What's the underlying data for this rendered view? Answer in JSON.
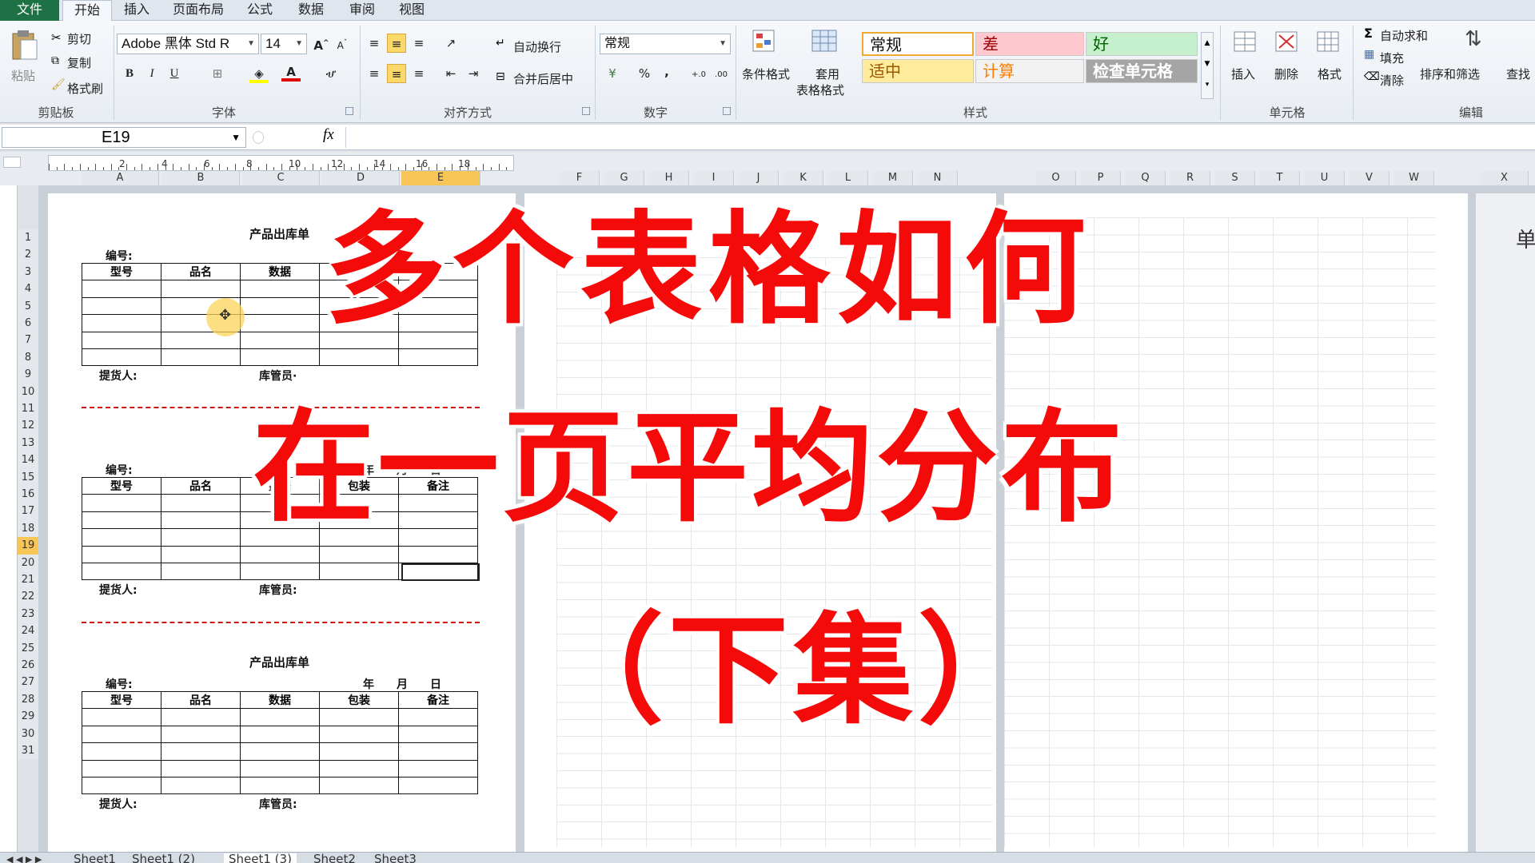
{
  "ribbon_tabs": [
    "文件",
    "开始",
    "插入",
    "页面布局",
    "公式",
    "数据",
    "审阅",
    "视图"
  ],
  "active_tab": "开始",
  "clipboard": {
    "paste": "粘贴",
    "cut": "剪切",
    "copy": "复制",
    "format_painter": "格式刷",
    "group": "剪贴板"
  },
  "font": {
    "name": "Adobe 黑体 Std R",
    "size": "14",
    "group": "字体",
    "bold": "B",
    "italic": "I",
    "underline": "U"
  },
  "alignment": {
    "wrap": "自动换行",
    "merge": "合并后居中",
    "group": "对齐方式"
  },
  "number": {
    "format": "常规",
    "percent": "%",
    "comma": ",",
    "group": "数字"
  },
  "styles": {
    "conditional": "条件格式",
    "table_fmt_1": "套用",
    "table_fmt_2": "表格格式",
    "cells": [
      {
        "label": "常规",
        "bg": "#ffffff",
        "fg": "#111111"
      },
      {
        "label": "差",
        "bg": "#ffc7ce",
        "fg": "#9c0006"
      },
      {
        "label": "好",
        "bg": "#c6efce",
        "fg": "#006100"
      },
      {
        "label": "适中",
        "bg": "#ffeb9c",
        "fg": "#9c5700"
      },
      {
        "label": "计算",
        "bg": "#f2f2f2",
        "fg": "#fa7d00"
      },
      {
        "label": "检查单元格",
        "bg": "#a5a5a5",
        "fg": "#ffffff"
      }
    ],
    "group": "样式"
  },
  "cells_group": {
    "insert": "插入",
    "delete": "删除",
    "format": "格式",
    "group": "单元格"
  },
  "editing": {
    "autosum": "自动求和",
    "fill": "填充",
    "clear": "清除",
    "sort": "排序和筛选",
    "find": "查找",
    "group": "编辑"
  },
  "formula_bar": {
    "name_box": "E19",
    "fx": "fx"
  },
  "ruler_numbers": [
    "2",
    "4",
    "6",
    "8",
    "10",
    "12",
    "14",
    "16",
    "18"
  ],
  "columns": [
    "A",
    "B",
    "C",
    "D",
    "E",
    "F",
    "G",
    "H",
    "I",
    "J",
    "K",
    "L",
    "M",
    "N",
    "O",
    "P",
    "Q",
    "R",
    "S",
    "T",
    "U",
    "V",
    "W",
    "X"
  ],
  "selected_column": "E",
  "rows": [
    "1",
    "2",
    "3",
    "4",
    "5",
    "6",
    "7",
    "8",
    "9",
    "10",
    "11",
    "12",
    "13",
    "14",
    "15",
    "16",
    "17",
    "18",
    "19",
    "20",
    "21",
    "22",
    "23",
    "24",
    "25",
    "26",
    "27",
    "28",
    "29",
    "30",
    "31"
  ],
  "selected_row": "19",
  "form": {
    "title": "产品出库单",
    "number_label": "编号:",
    "year": "年",
    "month": "月",
    "day": "日",
    "headers": [
      "型号",
      "品名",
      "数据",
      "包装",
      "备注"
    ],
    "picker": "提货人:",
    "keeper": "库管员:",
    "keeper_2": "库管员·"
  },
  "overlay_title": {
    "line1": "多个表格如何",
    "line2": "在一页平均分布",
    "line3": "（下集）",
    "color": "#f50a0a"
  },
  "right_edge_text": "单",
  "sheet_tabs": [
    "Sheet1",
    "Sheet1 (2)",
    "Sheet1 (3)",
    "Sheet2",
    "Sheet3"
  ],
  "active_sheet": "Sheet1 (3)"
}
